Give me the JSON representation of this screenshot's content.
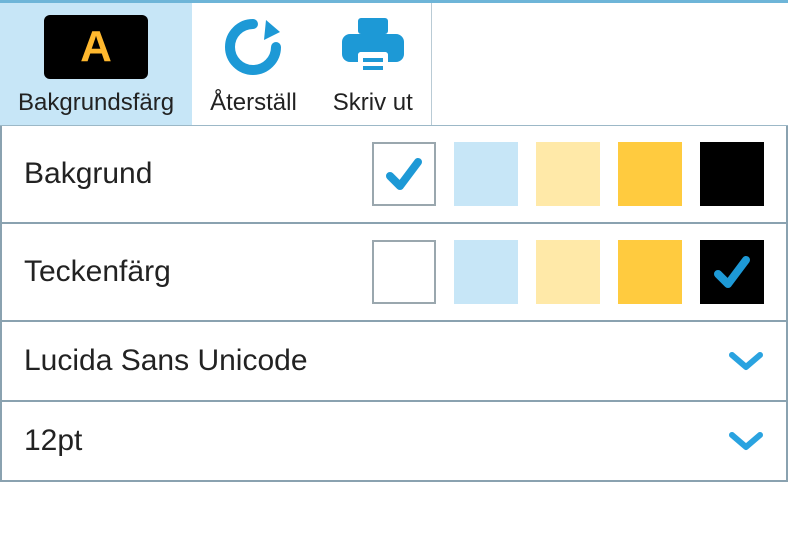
{
  "toolbar": {
    "bgcolor": {
      "label": "Bakgrundsfärg",
      "active": true
    },
    "reset": {
      "label": "Återställ"
    },
    "print": {
      "label": "Skriv ut"
    }
  },
  "rows": {
    "background": {
      "label": "Bakgrund",
      "swatches": [
        {
          "color": "#ffffff",
          "bordered": true,
          "checked": true
        },
        {
          "color": "#c7e6f7",
          "bordered": false,
          "checked": false
        },
        {
          "color": "#ffe9a8",
          "bordered": false,
          "checked": false
        },
        {
          "color": "#ffcb3f",
          "bordered": false,
          "checked": false
        },
        {
          "color": "#000000",
          "bordered": false,
          "checked": false
        }
      ]
    },
    "textcolor": {
      "label": "Teckenfärg",
      "swatches": [
        {
          "color": "#ffffff",
          "bordered": true,
          "checked": false
        },
        {
          "color": "#c7e6f7",
          "bordered": false,
          "checked": false
        },
        {
          "color": "#ffe9a8",
          "bordered": false,
          "checked": false
        },
        {
          "color": "#ffcb3f",
          "bordered": false,
          "checked": false
        },
        {
          "color": "#000000",
          "bordered": false,
          "checked": true
        }
      ]
    }
  },
  "font_dropdown": {
    "value": "Lucida Sans Unicode"
  },
  "size_dropdown": {
    "value": "12pt"
  },
  "colors": {
    "accent": "#2aa3e0",
    "check": "#1d99d6"
  }
}
